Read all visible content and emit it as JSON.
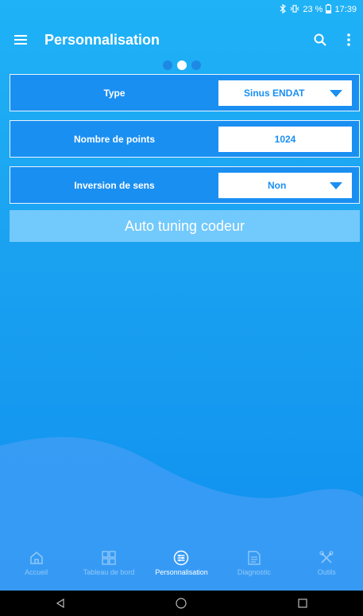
{
  "status_bar": {
    "icons": [
      "bluetooth-icon",
      "vibrate-icon"
    ],
    "battery_text": "23 %",
    "time": "17:39"
  },
  "app_bar": {
    "title": "Personnalisation",
    "actions": [
      "search-icon",
      "more-vertical-icon"
    ]
  },
  "pager": {
    "count": 3,
    "active_index": 1
  },
  "params": [
    {
      "label": "Type",
      "value": "Sinus ENDAT",
      "control": "dropdown"
    },
    {
      "label": "Nombre de points",
      "value": "1024",
      "control": "input"
    },
    {
      "label": "Inversion de sens",
      "value": "Non",
      "control": "dropdown"
    }
  ],
  "auto_tuning_label": "Auto tuning codeur",
  "bottom_nav": [
    {
      "label": "Accueil",
      "icon": "home-icon",
      "active": false
    },
    {
      "label": "Tableau de bord",
      "icon": "dashboard-icon",
      "active": false
    },
    {
      "label": "Personnalisation",
      "icon": "settings-sliders-icon",
      "active": true
    },
    {
      "label": "Diagnostic",
      "icon": "document-icon",
      "active": false
    },
    {
      "label": "Outils",
      "icon": "tools-icon",
      "active": false
    }
  ],
  "system_nav": [
    "back-icon",
    "home-circle-icon",
    "recents-icon"
  ]
}
